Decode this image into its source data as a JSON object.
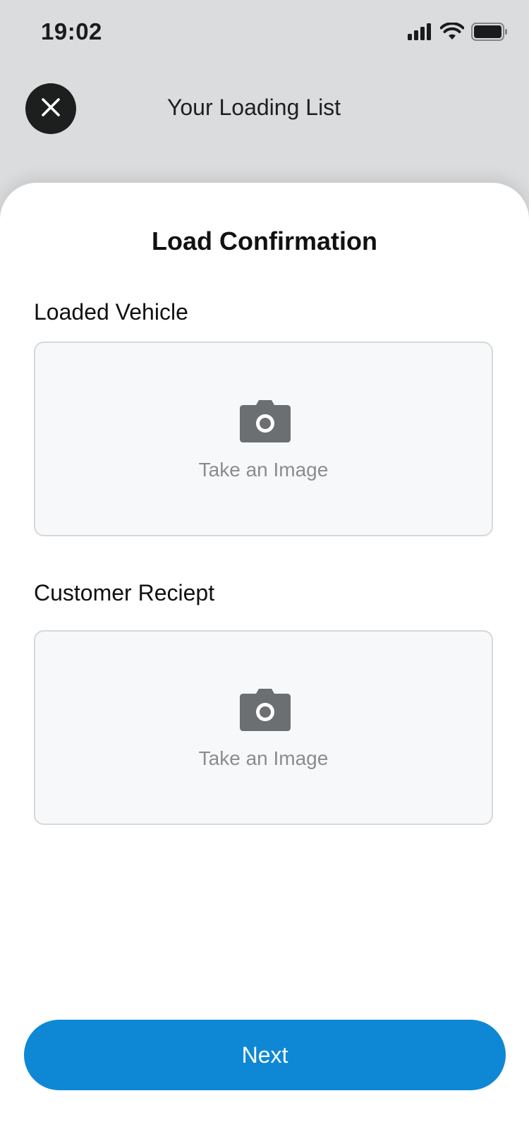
{
  "status_bar": {
    "time": "19:02",
    "icons": [
      "cellular-signal-icon",
      "wifi-icon",
      "battery-icon"
    ]
  },
  "header": {
    "close_icon": "close-icon",
    "title": "Your Loading List"
  },
  "sheet": {
    "title": "Load Confirmation",
    "sections": [
      {
        "label": "Loaded Vehicle",
        "upload_text": "Take an Image",
        "icon": "camera-icon"
      },
      {
        "label": "Customer Reciept",
        "upload_text": "Take an Image",
        "icon": "camera-icon"
      }
    ],
    "next_label": "Next"
  },
  "colors": {
    "background": "#dbdcde",
    "accent": "#0e88d5",
    "close_button": "#1d1f1f",
    "icon_gray": "#6b6f72",
    "placeholder_text": "#8a8c8e"
  }
}
